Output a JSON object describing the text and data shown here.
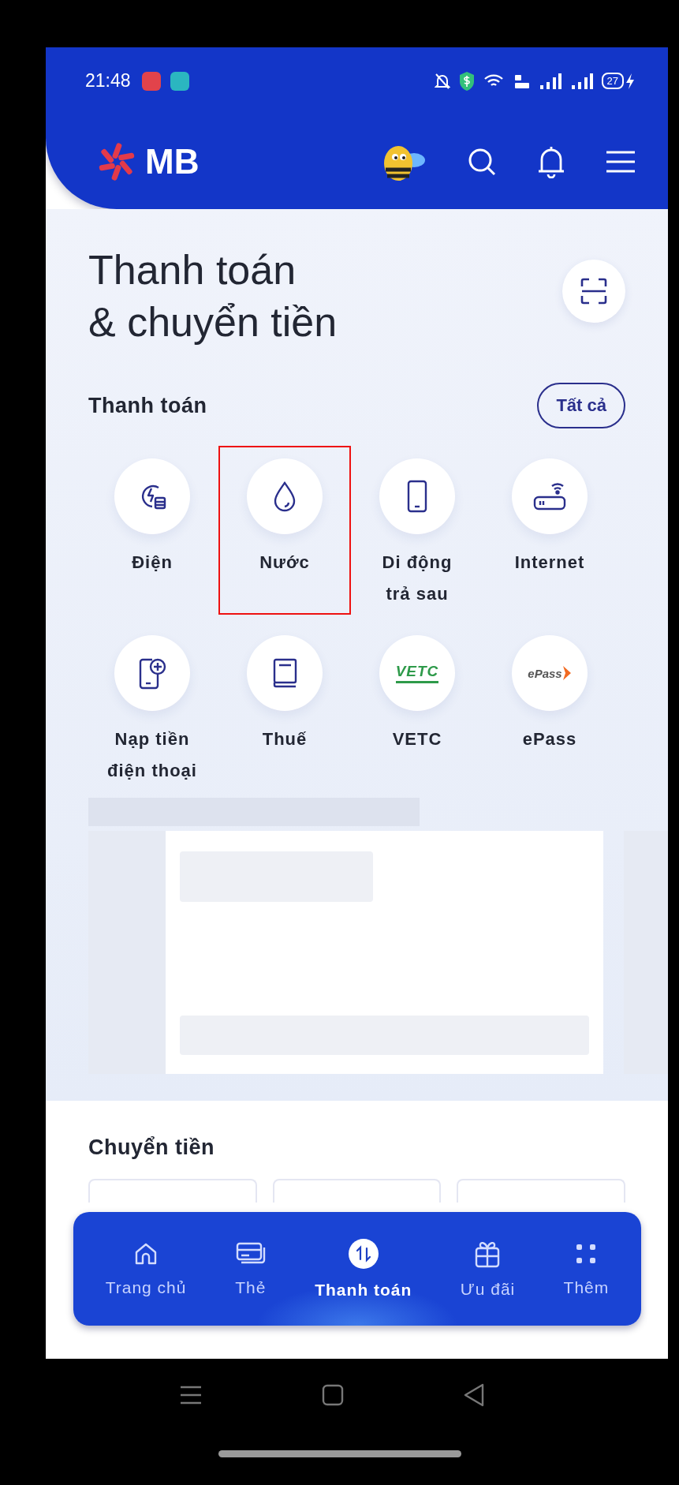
{
  "status_bar": {
    "time": "21:48",
    "battery": "27"
  },
  "header": {
    "logo": "MB"
  },
  "page_title": [
    "Thanh toán",
    "& chuyển tiền"
  ],
  "payments": {
    "heading": "Thanh toán",
    "see_all": "Tất cả",
    "items": [
      {
        "label": "Điện",
        "highlighted": false
      },
      {
        "label": "Nước",
        "highlighted": true
      },
      {
        "label": "Di động\ntrả sau",
        "highlighted": false
      },
      {
        "label": "Internet",
        "highlighted": false
      },
      {
        "label": "Nạp tiền\nđiện thoại",
        "highlighted": false
      },
      {
        "label": "Thuế",
        "highlighted": false
      },
      {
        "label": "VETC",
        "logo_text": "VETC",
        "highlighted": false
      },
      {
        "label": "ePass",
        "logo_text": "ePass",
        "highlighted": false
      }
    ]
  },
  "transfer": {
    "heading": "Chuyển tiền"
  },
  "bottom_nav": [
    {
      "label": "Trang chủ",
      "selected": false
    },
    {
      "label": "Thẻ",
      "selected": false
    },
    {
      "label": "Thanh toán",
      "selected": true
    },
    {
      "label": "Ưu đãi",
      "selected": false
    },
    {
      "label": "Thêm",
      "selected": false
    }
  ]
}
